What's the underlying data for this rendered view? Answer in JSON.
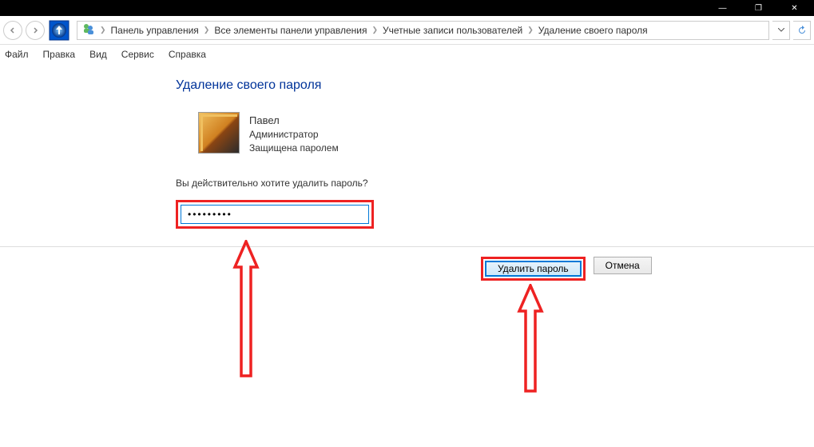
{
  "titlebar": {
    "minimize": "—",
    "maximize": "❐",
    "close": "✕"
  },
  "breadcrumb": {
    "items": [
      "Панель управления",
      "Все элементы панели управления",
      "Учетные записи пользователей",
      "Удаление своего пароля"
    ]
  },
  "menubar": {
    "file": "Файл",
    "edit": "Правка",
    "view": "Вид",
    "service": "Сервис",
    "help": "Справка"
  },
  "page": {
    "title": "Удаление своего пароля"
  },
  "user": {
    "name": "Павел",
    "role": "Администратор",
    "status": "Защищена паролем"
  },
  "prompt": "Вы действительно хотите удалить пароль?",
  "password": {
    "value": "•••••••••"
  },
  "buttons": {
    "delete": "Удалить пароль",
    "cancel": "Отмена"
  }
}
